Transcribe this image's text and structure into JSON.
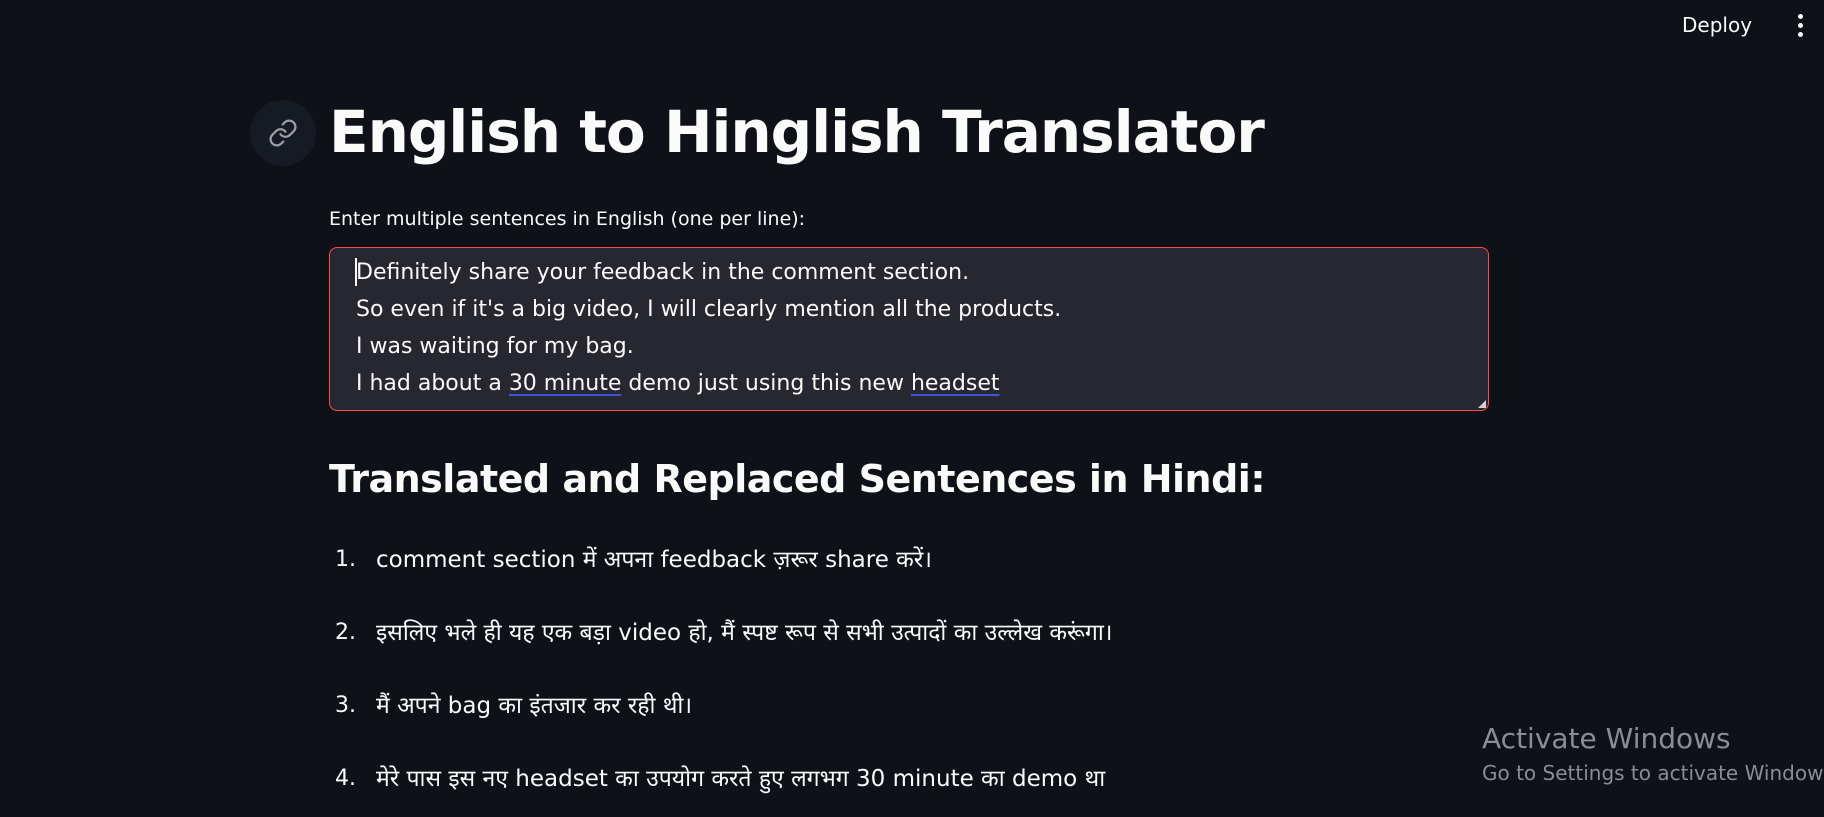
{
  "header": {
    "deploy_label": "Deploy",
    "menu_icon": "vertical-ellipsis-icon"
  },
  "main": {
    "title": "English to Hinglish Translator",
    "anchor_icon": "link-icon",
    "input": {
      "label": "Enter multiple sentences in English (one per line):",
      "lines": [
        "Definitely share your feedback in the comment section.",
        "So even if it's a big video, I will clearly mention all the products.",
        "I was waiting for my bag.",
        {
          "before": "I had about a ",
          "spell1": "30 minute",
          "middle": " demo just using this new ",
          "spell2": "headset"
        }
      ],
      "border_color": "#ff4b4b",
      "background_color": "#262730"
    },
    "results": {
      "heading": "Translated and Replaced Sentences in Hindi:",
      "items": [
        {
          "num": "1.",
          "text": "comment section में अपना feedback ज़रूर share करें।"
        },
        {
          "num": "2.",
          "text": "इसलिए भले ही यह एक बड़ा video हो, मैं स्पष्ट रूप से सभी उत्पादों का उल्लेख करूंगा।"
        },
        {
          "num": "3.",
          "text": "मैं अपने bag का इंतजार कर रही थी।"
        },
        {
          "num": "4.",
          "text": "मेरे पास इस नए headset का उपयोग करते हुए लगभग 30 minute का demo था"
        }
      ]
    }
  },
  "watermark": {
    "title": "Activate Windows",
    "subtitle": "Go to Settings to activate Windows."
  },
  "colors": {
    "background": "#0e1117",
    "text": "#fafafa",
    "spellcheck_underline": "#3a55d9"
  }
}
